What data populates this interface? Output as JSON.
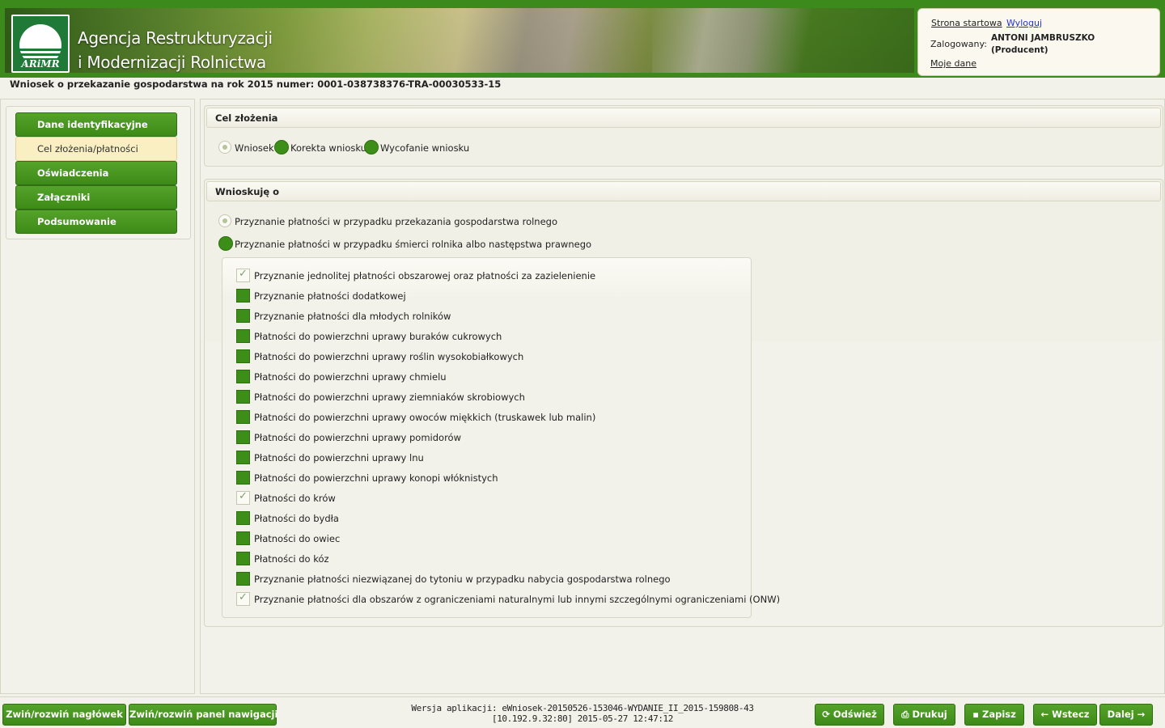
{
  "header": {
    "logo_text": "ARiMR",
    "agency_line1": "Agencja Restrukturyzacji",
    "agency_line2": "i Modernizacji Rolnictwa",
    "home_link": "Strona startowa",
    "logout_link": "Wyloguj",
    "logged_label": "Zalogowany:",
    "user_name": "ANTONI JAMBRUSZKO",
    "user_role": "(Producent)",
    "my_data_link": "Moje dane",
    "wniosek_title": "Wniosek o przekazanie gospodarstwa na rok 2015 numer: 0001-038738376-TRA-00030533-15"
  },
  "nav": {
    "items": [
      {
        "label": "Dane identyfikacyjne",
        "active": false
      },
      {
        "label": "Cel złożenia/płatności",
        "active": true
      },
      {
        "label": "Oświadczenia",
        "active": false
      },
      {
        "label": "Załączniki",
        "active": false
      },
      {
        "label": "Podsumowanie",
        "active": false
      }
    ]
  },
  "cel": {
    "title": "Cel złożenia",
    "options": [
      {
        "label": "Wniosek",
        "checked": true
      },
      {
        "label": "Korekta wniosku",
        "checked": false
      },
      {
        "label": "Wycofanie wniosku",
        "checked": false
      }
    ]
  },
  "wnioskuje": {
    "title": "Wnioskuję o",
    "options": [
      {
        "label": "Przyznanie płatności w przypadku przekazania gospodarstwa rolnego",
        "checked": true
      },
      {
        "label": "Przyznanie płatności w przypadku śmierci rolnika albo następstwa prawnego",
        "checked": false
      }
    ],
    "checkboxes": [
      {
        "label": "Przyznanie jednolitej płatności obszarowej oraz płatności za zazielenienie",
        "checked": true
      },
      {
        "label": "Przyznanie płatności dodatkowej",
        "checked": false
      },
      {
        "label": "Przyznanie płatności dla młodych rolników",
        "checked": false
      },
      {
        "label": "Płatności do powierzchni uprawy buraków cukrowych",
        "checked": false
      },
      {
        "label": "Płatności do powierzchni uprawy roślin wysokobiałkowych",
        "checked": false
      },
      {
        "label": "Płatności do powierzchni uprawy chmielu",
        "checked": false
      },
      {
        "label": "Płatności do powierzchni uprawy ziemniaków skrobiowych",
        "checked": false
      },
      {
        "label": "Płatności do powierzchni uprawy owoców miękkich (truskawek lub malin)",
        "checked": false
      },
      {
        "label": "Płatności do powierzchni uprawy pomidorów",
        "checked": false
      },
      {
        "label": "Płatności do powierzchni uprawy lnu",
        "checked": false
      },
      {
        "label": "Płatności do powierzchni uprawy konopi włóknistych",
        "checked": false
      },
      {
        "label": "Płatności do krów",
        "checked": true
      },
      {
        "label": "Płatności do bydła",
        "checked": false
      },
      {
        "label": "Płatności do owiec",
        "checked": false
      },
      {
        "label": "Płatności do kóz",
        "checked": false
      },
      {
        "label": "Przyznanie płatności niezwiązanej do tytoniu w przypadku nabycia gospodarstwa rolnego",
        "checked": false
      },
      {
        "label": "Przyznanie płatności dla obszarów z ograniczeniami naturalnymi lub innymi szczególnymi ograniczeniami (ONW)",
        "checked": true
      }
    ]
  },
  "footer": {
    "toggle_header": "Zwiń/rozwiń nagłówek",
    "toggle_nav": "Zwiń/rozwiń panel nawigacji",
    "version_line1": "Wersja aplikacji: eWniosek-20150526-153046-WYDANIE_II_2015-159808-43",
    "version_line2": "[10.192.9.32:80] 2015-05-27 12:47:12",
    "refresh": "Odśwież",
    "print": "Drukuj",
    "save": "Zapisz",
    "back": "Wstecz",
    "next": "Dalej"
  },
  "icons": {
    "refresh": "refresh-icon",
    "print": "print-icon",
    "save": "save-icon",
    "back": "arrow-left-icon",
    "next": "arrow-right-icon"
  },
  "colors": {
    "accent_green": "#3d8e18",
    "active_nav": "#f9efc3",
    "logout_link": "#2233cc"
  }
}
